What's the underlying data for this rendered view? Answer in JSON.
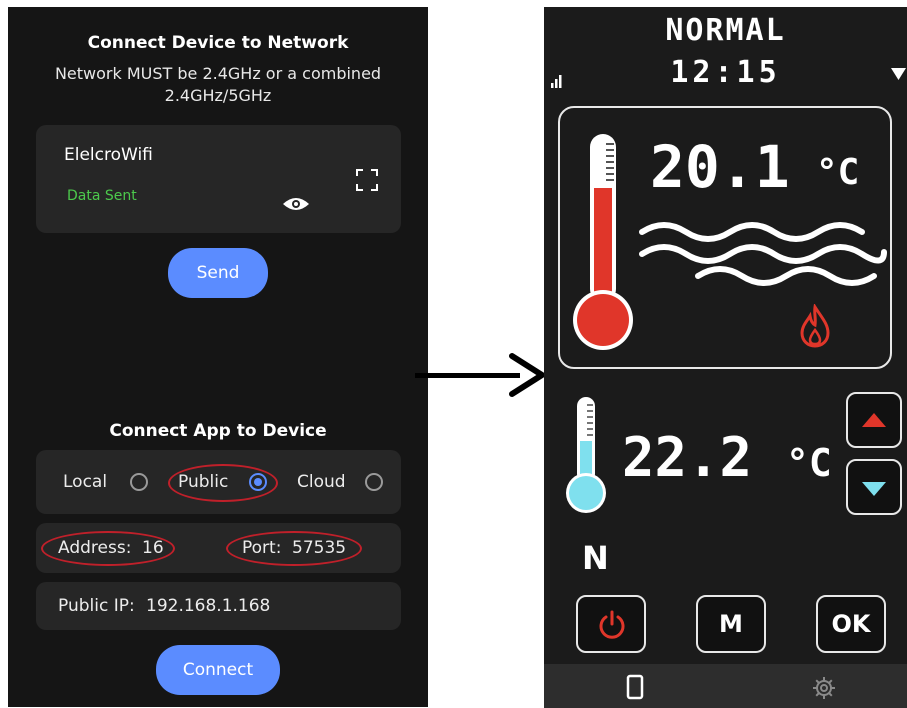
{
  "left": {
    "title1": "Connect Device to Network",
    "subtitle1": "Network MUST be 2.4GHz or a combined",
    "subtitle2": "2.4GHz/5GHz",
    "wifi_name": "ElelcroWifi",
    "status": "Data Sent",
    "send_label": "Send",
    "title2": "Connect App to Device",
    "radios": {
      "local": "Local",
      "public": "Public",
      "cloud": "Cloud",
      "selected": "Public"
    },
    "address_label": "Address:",
    "address_value": "16",
    "port_label": "Port:",
    "port_value": "57535",
    "public_ip_label": "Public IP:",
    "public_ip_value": "192.168.1.168",
    "connect_label": "Connect"
  },
  "right": {
    "mode": "NORMAL",
    "time": "12:15",
    "temp_current": "20.1",
    "temp_set": "22.2",
    "unit": "°C",
    "mode_letter": "N",
    "m_label": "M",
    "ok_label": "OK"
  },
  "colors": {
    "accent_blue": "#5b8cff",
    "status_green": "#4cc94c",
    "highlight_red": "#c0202a",
    "hot_red": "#e0362a",
    "cold_cyan": "#7fe0ee"
  },
  "icons": {
    "eye": "eye-icon",
    "scan": "scan-icon",
    "flame": "flame-icon",
    "power": "power-icon",
    "phone": "phone-icon",
    "gear": "gear-icon",
    "signal": "signal-icon"
  }
}
